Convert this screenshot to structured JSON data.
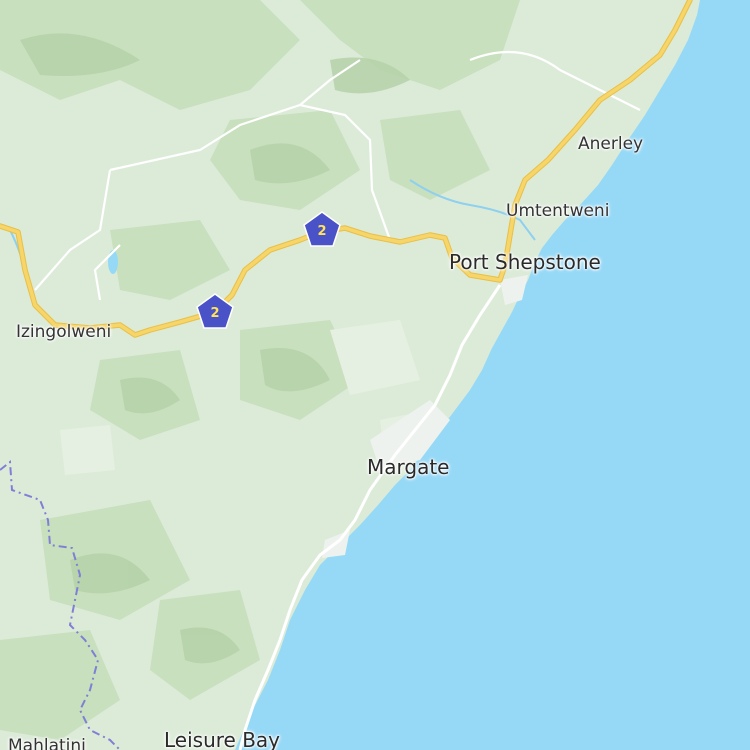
{
  "map": {
    "colors": {
      "land": "#dcebd8",
      "forest": "#cfe3c6",
      "hills": "#b9d4ae",
      "water": "#96d9f7",
      "major_road": "#f6d56a",
      "minor_road": "#ffffff",
      "border": "#7f7fd6",
      "route_shield": "#4a52c7",
      "shield_text": "#ffe35a"
    },
    "places": [
      {
        "name": "Anerley",
        "type": "town"
      },
      {
        "name": "Umtentweni",
        "type": "town"
      },
      {
        "name": "Port Shepstone",
        "type": "city"
      },
      {
        "name": "Izingolweni",
        "type": "town"
      },
      {
        "name": "Margate",
        "type": "city"
      },
      {
        "name": "Leisure Bay",
        "type": "city"
      },
      {
        "name": "Mahlatini",
        "type": "town"
      }
    ],
    "route_shields": [
      {
        "label": "2",
        "icon": "pentagon-route-shield"
      },
      {
        "label": "2",
        "icon": "pentagon-route-shield"
      }
    ],
    "features": [
      "ocean",
      "coastline",
      "major-highway",
      "minor-roads",
      "rivers",
      "administrative-border",
      "terrain-hills"
    ]
  }
}
